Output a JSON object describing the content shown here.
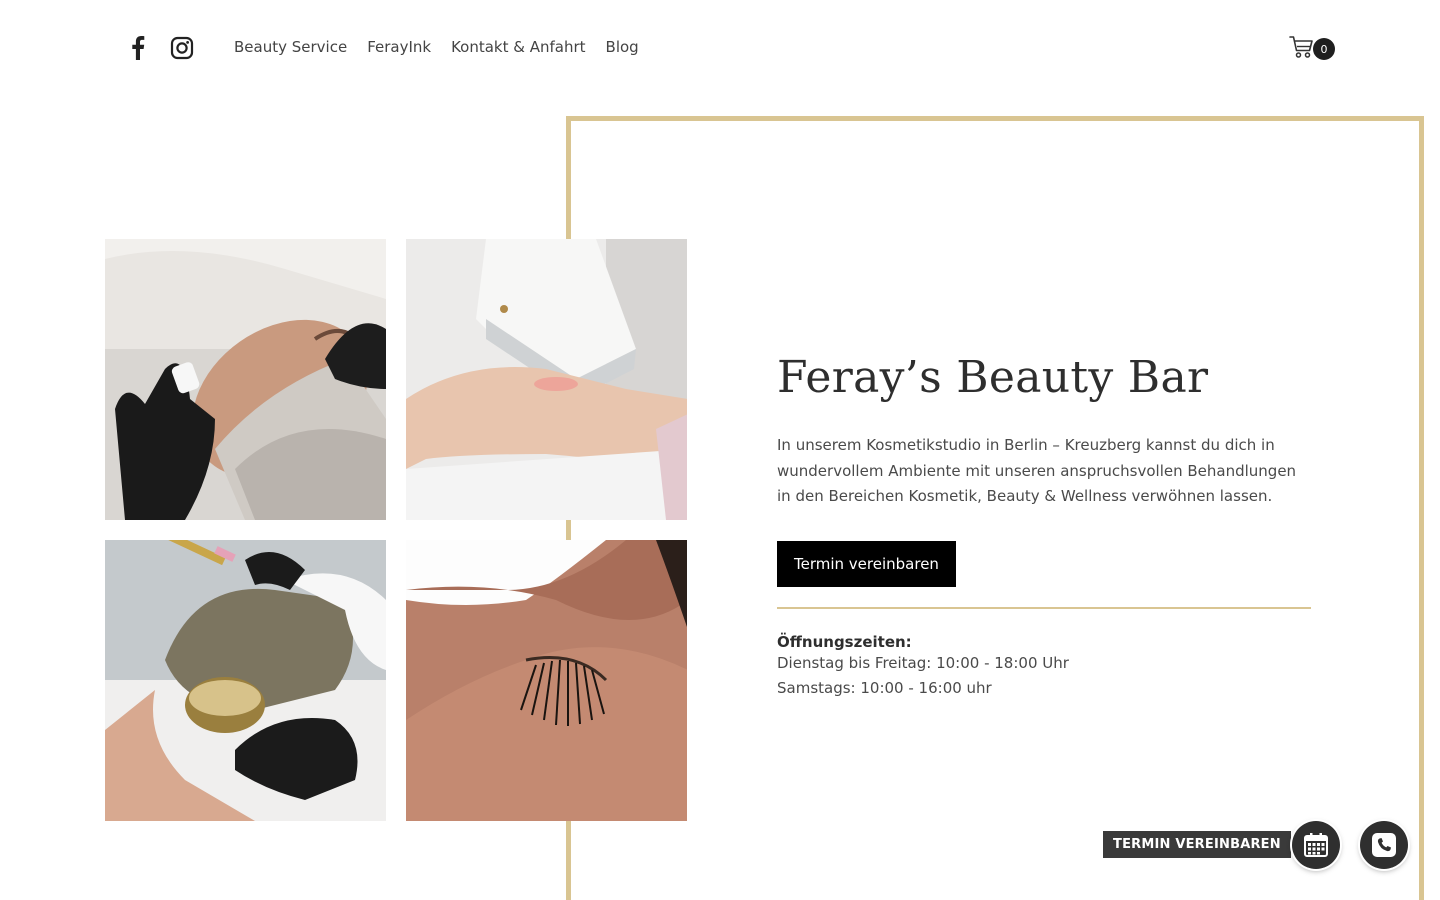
{
  "header": {
    "social": [
      {
        "name": "facebook-icon"
      },
      {
        "name": "instagram-icon"
      }
    ],
    "nav": [
      {
        "label": "Beauty Service"
      },
      {
        "label": "FerayInk"
      },
      {
        "label": "Kontakt & Anfahrt"
      },
      {
        "label": "Blog"
      }
    ],
    "cart": {
      "count": "0",
      "icon": "cart-icon"
    }
  },
  "hero": {
    "title": "Feray’s Beauty Bar",
    "description": "In unserem Kosmetikstudio in Berlin – Kreuzberg kannst du dich in wundervollem Ambiente mit unseren anspruchsvollen Behandlungen in den Bereichen Kosmetik, Beauty & Wellness verwöhnen lassen.",
    "cta_label": "Termin vereinbaren",
    "hours_title": "Öffnungszeiten:",
    "hours": [
      "Dienstag bis Freitag: 10:00 - 18:00 Uhr",
      "Samstags: 10:00 - 16:00 uhr"
    ]
  },
  "floating": {
    "label": "TERMIN VEREINBAREN",
    "calendar_icon": "calendar-icon",
    "phone_icon": "phone-icon"
  },
  "colors": {
    "accent_gold": "#d9c592",
    "button_black": "#000000",
    "float_dark": "#2f2f2f"
  }
}
